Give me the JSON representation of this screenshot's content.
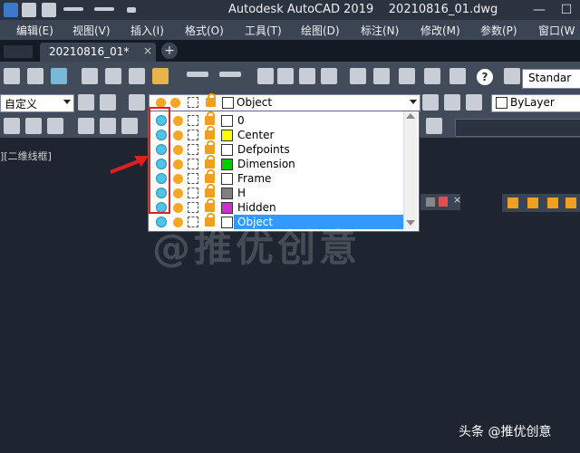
{
  "window": {
    "app_title": "Autodesk AutoCAD 2019",
    "file_name": "20210816_01.dwg",
    "controls": [
      "—",
      "☐"
    ]
  },
  "menu": [
    "编辑(E)",
    "视图(V)",
    "插入(I)",
    "格式(O)",
    "工具(T)",
    "绘图(D)",
    "标注(N)",
    "修改(M)",
    "参数(P)",
    "窗口(W"
  ],
  "tabs": {
    "active": "20210816_01*",
    "close": "×",
    "add": "+"
  },
  "toolbar": {
    "workspace": "自定义",
    "text_style": "Standar",
    "bylayer": "ByLayer",
    "help": "?"
  },
  "layer_combo": {
    "current": "Object"
  },
  "layers": [
    {
      "name": "0",
      "color": "#ffffff"
    },
    {
      "name": "Center",
      "color": "#ffff00"
    },
    {
      "name": "Defpoints",
      "color": "#ffffff"
    },
    {
      "name": "Dimension",
      "color": "#00cc00"
    },
    {
      "name": "Frame",
      "color": "#ffffff"
    },
    {
      "name": "H",
      "color": "#808080"
    },
    {
      "name": "Hidden",
      "color": "#cc33cc"
    },
    {
      "name": "Object",
      "color": "#ffffff",
      "selected": true
    }
  ],
  "viewport_label": "][二维线框]",
  "watermark": "@推优创意",
  "credit": "头条 @推优创意",
  "colors": {
    "accent": "#3399ff",
    "highlight": "#e02020",
    "background": "#1e2531"
  }
}
